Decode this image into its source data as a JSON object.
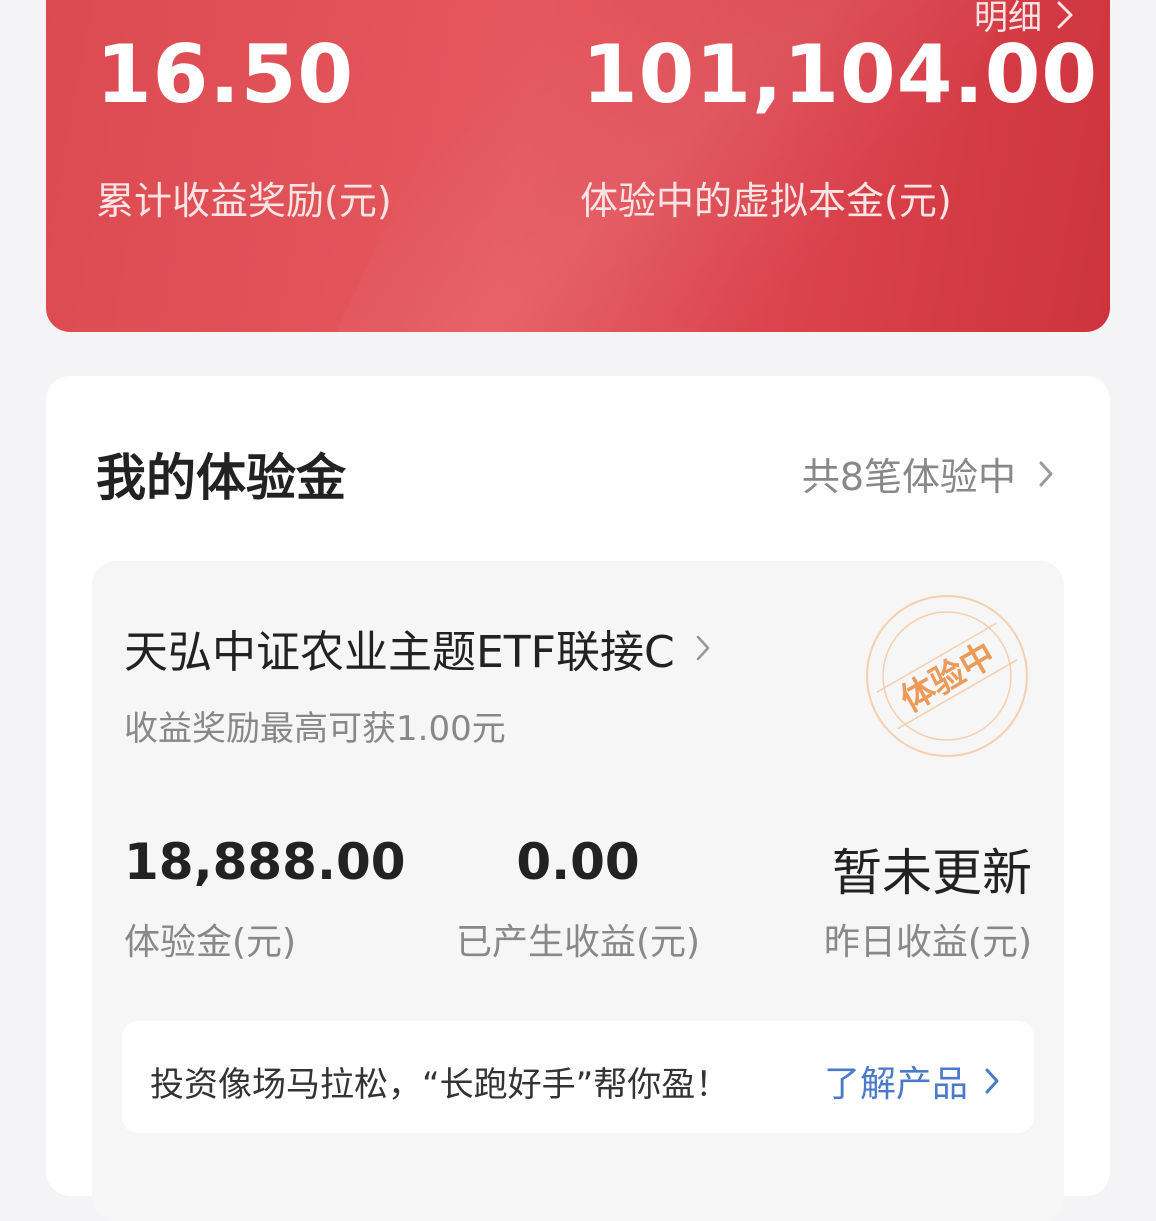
{
  "header": {
    "detail_label": "明细",
    "total_reward_value": "16.50",
    "total_reward_label": "累计收益奖励(元)",
    "virtual_principal_value": "101,104.00",
    "virtual_principal_label": "体验中的虚拟本金(元)"
  },
  "section": {
    "title": "我的体验金",
    "summary": "共8笔体验中"
  },
  "fund": {
    "name": "天弘中证农业主题ETF联接C",
    "subtitle": "收益奖励最高可获1.00元",
    "stamp_text": "体验中",
    "metrics": [
      {
        "value": "18,888.00",
        "label": "体验金(元)"
      },
      {
        "value": "0.00",
        "label": "已产生收益(元)"
      },
      {
        "value": "暂未更新",
        "label": "昨日收益(元)"
      }
    ],
    "promo_text": "投资像场马拉松，“长跑好手”帮你盈！",
    "promo_link": "了解产品"
  },
  "colors": {
    "header_red": "#e0525a",
    "stamp_orange": "#f0a060",
    "link_blue": "#4a7ac8"
  },
  "icons": {
    "chevron": "chevron-right-icon"
  }
}
